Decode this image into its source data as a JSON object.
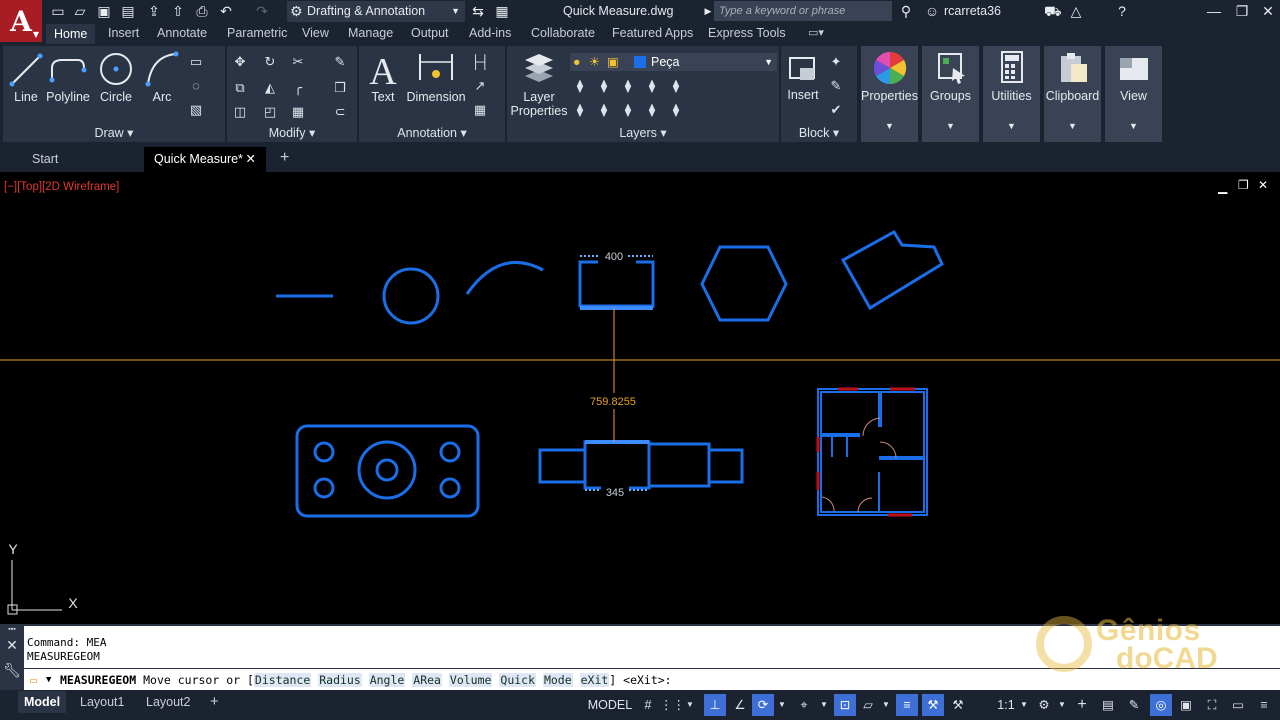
{
  "app": {
    "logo_letter": "A",
    "workspace": "Drafting & Annotation",
    "document_title": "Quick Measure.dwg",
    "search_placeholder": "Type a keyword or phrase",
    "user": "rcarreta36"
  },
  "ribbon_tabs": [
    "Home",
    "Insert",
    "Annotate",
    "Parametric",
    "View",
    "Manage",
    "Output",
    "Add-ins",
    "Collaborate",
    "Featured Apps",
    "Express Tools"
  ],
  "panels": {
    "draw": {
      "title": "Draw",
      "buttons": [
        "Line",
        "Polyline",
        "Circle",
        "Arc"
      ]
    },
    "modify": {
      "title": "Modify"
    },
    "annotation": {
      "title": "Annotation",
      "buttons": [
        "Text",
        "Dimension"
      ]
    },
    "layers": {
      "title": "Layers",
      "layer_properties": "Layer Properties",
      "current_layer": "Peça"
    },
    "block": {
      "title": "Block",
      "insert": "Insert"
    },
    "properties": "Properties",
    "groups": "Groups",
    "utilities": "Utilities",
    "clipboard": "Clipboard",
    "view": "View"
  },
  "doc_tabs": [
    "Start",
    "Quick Measure*"
  ],
  "viewport": {
    "label": "[−][Top][2D Wireframe]",
    "measurements": {
      "top_width": "400",
      "vertical_distance": "759.8255",
      "bottom_width": "345"
    },
    "ucs": {
      "x": "X",
      "y": "Y"
    }
  },
  "command": {
    "history": [
      "Command: MEA",
      "MEASUREGEOM"
    ],
    "prompt_cmd": "MEASUREGEOM",
    "prompt_text": "Move cursor or [",
    "options": [
      "Distance",
      "Radius",
      "Angle",
      "ARea",
      "Volume",
      "Quick",
      "Mode",
      "eXit"
    ],
    "prompt_tail": "] <eXit>:"
  },
  "watermark": {
    "line1": "Gênios",
    "line2": "doCAD"
  },
  "status": {
    "layouts": [
      "Model",
      "Layout1",
      "Layout2"
    ],
    "model_label": "MODEL",
    "scale": "1:1"
  },
  "colors": {
    "accent": "#1a6ee8",
    "measure": "#e8a020",
    "wall_red": "#c0101a"
  }
}
